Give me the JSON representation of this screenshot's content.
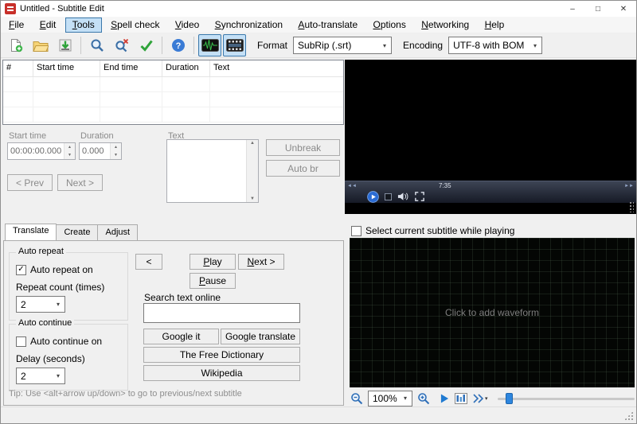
{
  "window": {
    "title": "Untitled - Subtitle Edit",
    "controls": {
      "minimize": "–",
      "maximize": "□",
      "close": "✕"
    }
  },
  "menu": {
    "items": [
      "File",
      "Edit",
      "Tools",
      "Spell check",
      "Video",
      "Synchronization",
      "Auto-translate",
      "Options",
      "Networking",
      "Help"
    ]
  },
  "toolbar": {
    "format_label": "Format",
    "format_value": "SubRip (.srt)",
    "encoding_label": "Encoding",
    "encoding_value": "UTF-8 with BOM"
  },
  "subtitle_list": {
    "columns": [
      "#",
      "Start time",
      "End time",
      "Duration",
      "Text"
    ]
  },
  "editor": {
    "start_time_label": "Start time",
    "start_time_value": "00:00:00.000",
    "duration_label": "Duration",
    "duration_value": "0.000",
    "text_label": "Text",
    "unbreak_label": "Unbreak",
    "auto_br_label": "Auto br",
    "prev_label": "< Prev",
    "next_label": "Next >"
  },
  "player": {
    "position_text": "7:35"
  },
  "tabs": {
    "translate": "Translate",
    "create": "Create",
    "adjust": "Adjust"
  },
  "translate": {
    "auto_repeat_title": "Auto repeat",
    "auto_repeat_checkbox": "Auto repeat on",
    "repeat_count_label": "Repeat count (times)",
    "repeat_count_value": "2",
    "auto_continue_title": "Auto continue",
    "auto_continue_checkbox": "Auto continue on",
    "delay_label": "Delay (seconds)",
    "delay_value": "2",
    "back_label": "<",
    "play_label": "Play",
    "next_label": "Next >",
    "pause_label": "Pause",
    "search_label": "Search text online",
    "google_it_label": "Google it",
    "google_translate_label": "Google translate",
    "free_dictionary_label": "The Free Dictionary",
    "wikipedia_label": "Wikipedia",
    "tip": "Tip: Use <alt+arrow up/down> to go to previous/next subtitle"
  },
  "waveform": {
    "select_checkbox": "Select current subtitle while playing",
    "hint": "Click to add waveform",
    "zoom_value": "100%"
  },
  "icons": {
    "combo_arrow": "▾",
    "arrow_up": "▲",
    "arrow_down": "▼",
    "check": "✓",
    "rewind": "◄◄",
    "forward": "►►"
  }
}
